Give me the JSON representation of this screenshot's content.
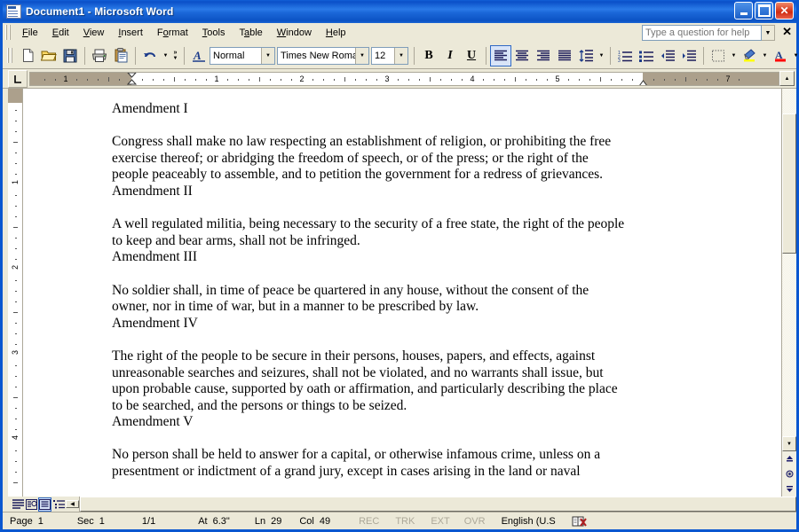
{
  "window": {
    "title": "Document1 - Microsoft Word",
    "app_icon": "word-document-icon",
    "minimize_label": "Minimize",
    "maximize_label": "Maximize",
    "close_label": "Close"
  },
  "menubar": {
    "items": [
      {
        "label": "File",
        "mnemonic": "F"
      },
      {
        "label": "Edit",
        "mnemonic": "E"
      },
      {
        "label": "View",
        "mnemonic": "V"
      },
      {
        "label": "Insert",
        "mnemonic": "I"
      },
      {
        "label": "Format",
        "mnemonic": "o"
      },
      {
        "label": "Tools",
        "mnemonic": "T"
      },
      {
        "label": "Table",
        "mnemonic": "a"
      },
      {
        "label": "Window",
        "mnemonic": "W"
      },
      {
        "label": "Help",
        "mnemonic": "H"
      }
    ],
    "help_placeholder": "Type a question for help",
    "close_label": "✕"
  },
  "toolbar": {
    "buttons": [
      {
        "name": "new-document",
        "label": "New Blank Document"
      },
      {
        "name": "open",
        "label": "Open"
      },
      {
        "name": "save",
        "label": "Save"
      },
      {
        "name": "print",
        "label": "Print"
      },
      {
        "name": "paste",
        "label": "Paste"
      },
      {
        "name": "undo",
        "label": "Undo"
      },
      {
        "name": "more-buttons",
        "label": "Toolbar Options"
      },
      {
        "name": "styles-formatting",
        "label": "Styles and Formatting"
      }
    ],
    "style_value": "Normal",
    "font_value": "Times New Roman",
    "size_value": "12",
    "bold_label": "B",
    "italic_label": "I",
    "underline_label": "U",
    "align_left_label": "Align Left",
    "align_center_label": "Center",
    "align_right_label": "Align Right",
    "justify_label": "Justify",
    "line_spacing_label": "Line Spacing",
    "numbering_label": "Numbering",
    "bullets_label": "Bullets",
    "decrease_indent_label": "Decrease Indent",
    "increase_indent_label": "Increase Indent",
    "borders_label": "Borders",
    "highlight_label": "Highlight",
    "font_color_label": "Font Color",
    "overflow_label": "More Buttons"
  },
  "ruler": {
    "horizontal_numbers": [
      "1",
      "1",
      "2",
      "3",
      "4",
      "5",
      "7"
    ],
    "vertical_numbers": [
      "1",
      "2",
      "3",
      "4"
    ],
    "tab_stop_type": "left-tab",
    "left_indent_marker": "first-line-indent",
    "right_indent_marker": "right-indent"
  },
  "document": {
    "paragraphs": [
      {
        "text": "Amendment I"
      },
      {
        "text": ""
      },
      {
        "text": "Congress shall make no law respecting an establishment of religion, or prohibiting the free exercise thereof; or abridging the freedom of speech, or of the press; or the right of the people peaceably to assemble, and to petition the government for a redress of grievances."
      },
      {
        "text": "Amendment II"
      },
      {
        "text": ""
      },
      {
        "text": "A well regulated militia, being necessary to the security of a free state, the right of the people to keep and bear arms, shall not be infringed."
      },
      {
        "text": "Amendment III"
      },
      {
        "text": ""
      },
      {
        "text": "No soldier shall, in time of peace be quartered in any house, without the consent of the owner, nor in time of war, but in a manner to be prescribed by law."
      },
      {
        "text": "Amendment IV"
      },
      {
        "text": ""
      },
      {
        "text": "The right of the people to be secure in their persons, houses, papers, and effects, against unreasonable searches and seizures, shall not be violated, and no warrants shall issue, but upon probable cause, supported by oath or affirmation, and particularly describing the place to be searched, and the persons or things to be seized."
      },
      {
        "text": "Amendment V"
      },
      {
        "text": ""
      },
      {
        "text": "No person shall be held to answer for a capital, or otherwise infamous crime, unless on a presentment or indictment of a grand jury, except in cases arising in the land or naval"
      }
    ]
  },
  "view_buttons": [
    {
      "name": "normal-view",
      "label": "Normal View",
      "selected": false
    },
    {
      "name": "web-layout-view",
      "label": "Web Layout View",
      "selected": false
    },
    {
      "name": "print-layout-view",
      "label": "Print Layout View",
      "selected": true
    },
    {
      "name": "outline-view",
      "label": "Outline View",
      "selected": false
    }
  ],
  "statusbar": {
    "page_label": "Page",
    "page_value": "1",
    "sec_label": "Sec",
    "sec_value": "1",
    "page_of_total": "1/1",
    "at_label": "At",
    "at_value": "6.3\"",
    "ln_label": "Ln",
    "ln_value": "29",
    "col_label": "Col",
    "col_value": "49",
    "rec": "REC",
    "trk": "TRK",
    "ext": "EXT",
    "ovr": "OVR",
    "language": "English (U.S",
    "spellcheck_icon": "spelling-grammar-icon"
  },
  "colors": {
    "title_gradient_start": "#1160d8",
    "title_gradient_end": "#0b52c4",
    "window_border": "#0a57d0",
    "chrome": "#ece9d8",
    "chrome_border": "#aca899",
    "ruler_margin": "#aca08c",
    "accent_blue": "#316ac5",
    "disabled_text": "#aca899",
    "highlight_yellow": "#ffff00",
    "font_color_red": "#ff0000"
  }
}
